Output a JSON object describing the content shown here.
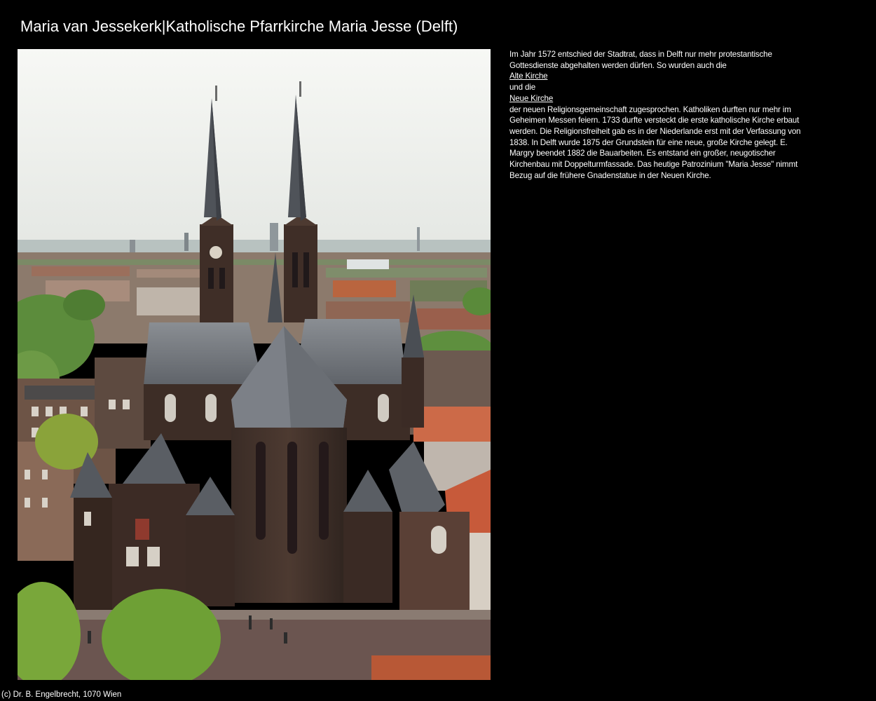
{
  "page": {
    "title": "Maria van Jessekerk|Katholische Pfarrkirche Maria Jesse (Delft)"
  },
  "description": {
    "text_1": "Im Jahr 1572 entschied der Stadtrat, dass in Delft nur mehr protestantische Gottesdienste abgehalten werden dürfen. So wurden auch die",
    "link_1": "Alte Kirche",
    "text_2": "und die",
    "link_2": "Neue Kirche",
    "text_3": "der neuen Religionsgemeinschaft zugesprochen. Katholiken durften nur mehr im Geheimen Messen feiern. 1733 durfte versteckt die erste katholische Kirche erbaut werden. Die Religionsfreiheit gab es in der Niederlande erst mit der Verfassung von 1838. In Delft wurde 1875 der Grundstein für eine neue, große Kirche gelegt. E. Margry beendet 1882 die Bauarbeiten. Es entstand ein großer, neugotischer Kirchenbau mit Doppelturmfassade. Das heutige Patrozinium \"Maria Jesse\" nimmt Bezug auf die frühere Gnadenstatue in der Neuen Kirche."
  },
  "footer": {
    "copyright": "(c) Dr. B. Engelbrecht, 1070 Wien"
  },
  "colors": {
    "background": "#000000",
    "text": "#ffffff"
  }
}
